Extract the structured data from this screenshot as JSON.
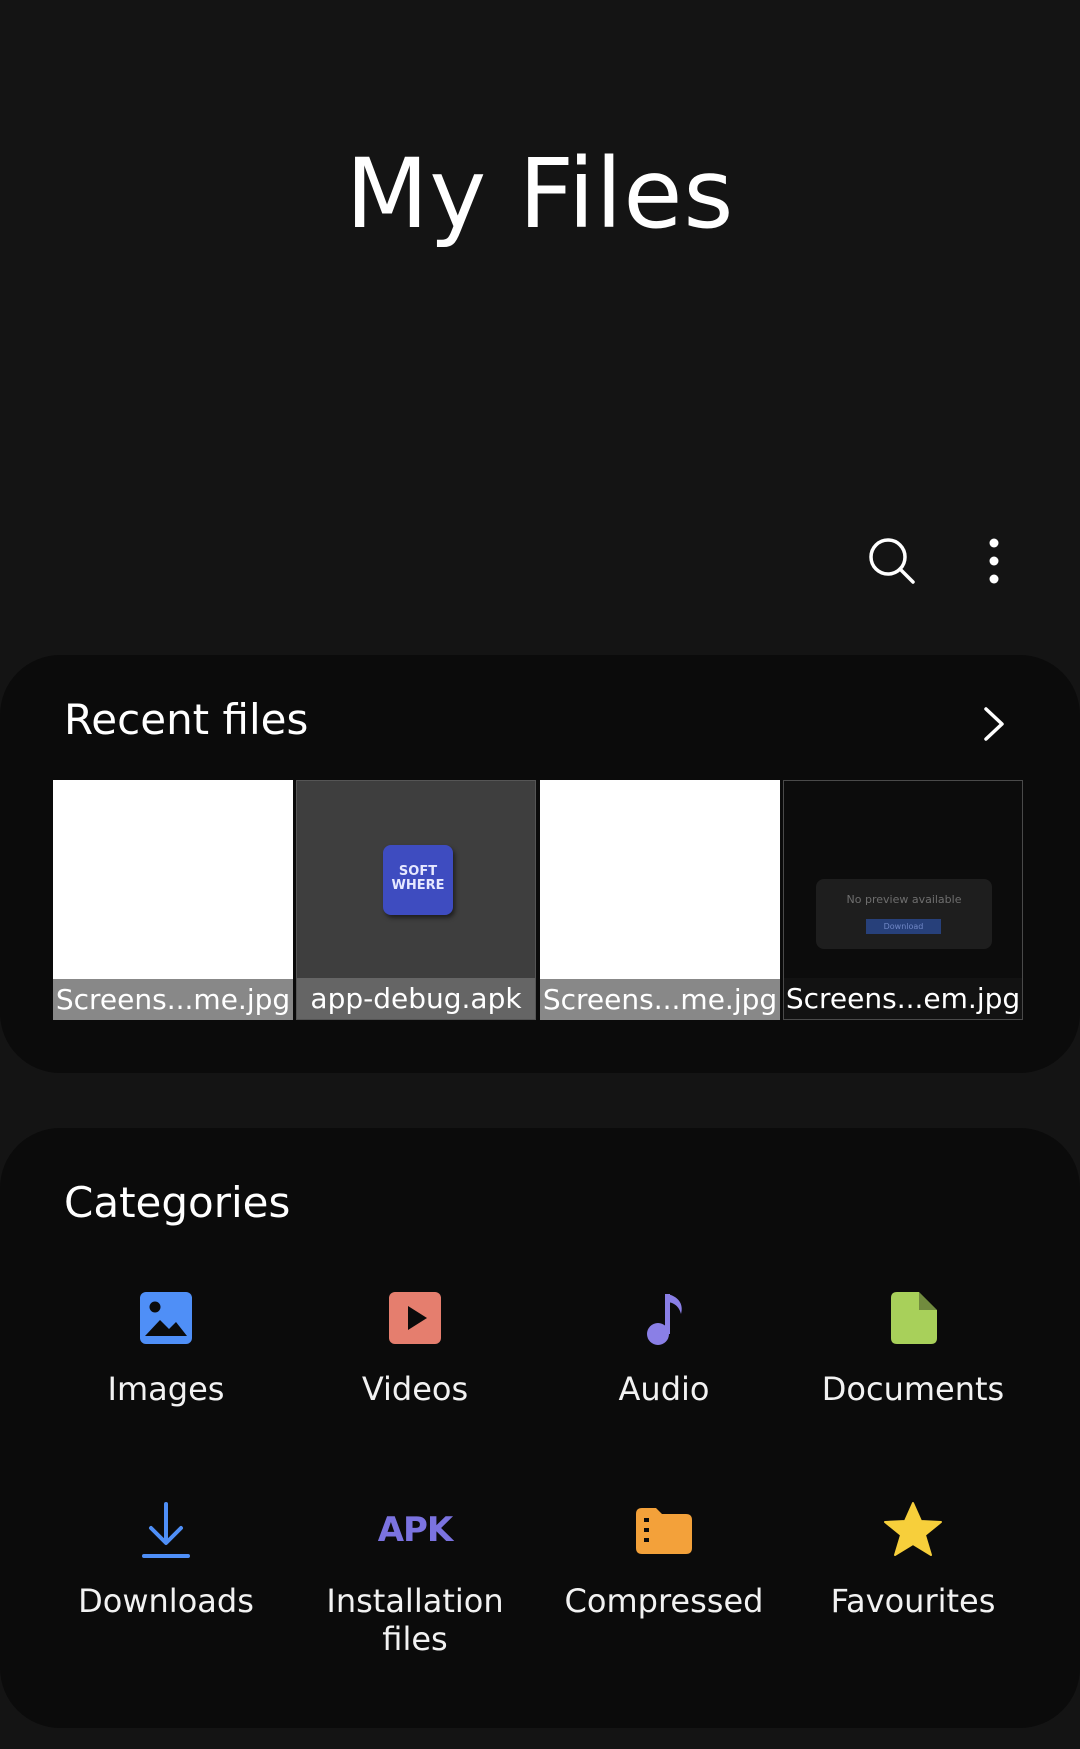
{
  "header": {
    "title": "My Files",
    "search_icon": "search-icon",
    "more_icon": "more-options-icon"
  },
  "recent": {
    "title": "Recent files",
    "files": [
      {
        "name": "Screens...me.jpg",
        "preview": "white"
      },
      {
        "name": "app-debug.apk",
        "preview": "apk-logo",
        "logo_text": "SOFT WHERE"
      },
      {
        "name": "Screens...me.jpg",
        "preview": "white"
      },
      {
        "name": "Screens...em.jpg",
        "preview": "dark",
        "preview_text": "No preview available",
        "preview_button": "Download"
      }
    ]
  },
  "categories": {
    "title": "Categories",
    "items": [
      {
        "label": "Images",
        "icon": "image-icon",
        "color": "#4f8ff7"
      },
      {
        "label": "Videos",
        "icon": "video-icon",
        "color": "#e57e6e"
      },
      {
        "label": "Audio",
        "icon": "music-note-icon",
        "color": "#8a7fe6"
      },
      {
        "label": "Documents",
        "icon": "document-icon",
        "color": "#a8d05a"
      },
      {
        "label": "Downloads",
        "icon": "download-icon",
        "color": "#4f8ff7"
      },
      {
        "label": "Installation files",
        "icon": "apk-icon",
        "icon_text": "APK",
        "color": "#7b73e0"
      },
      {
        "label": "Compressed",
        "icon": "folder-icon",
        "color": "#f3a13a"
      },
      {
        "label": "Favourites",
        "icon": "star-icon",
        "color": "#f7cf3b"
      }
    ]
  }
}
